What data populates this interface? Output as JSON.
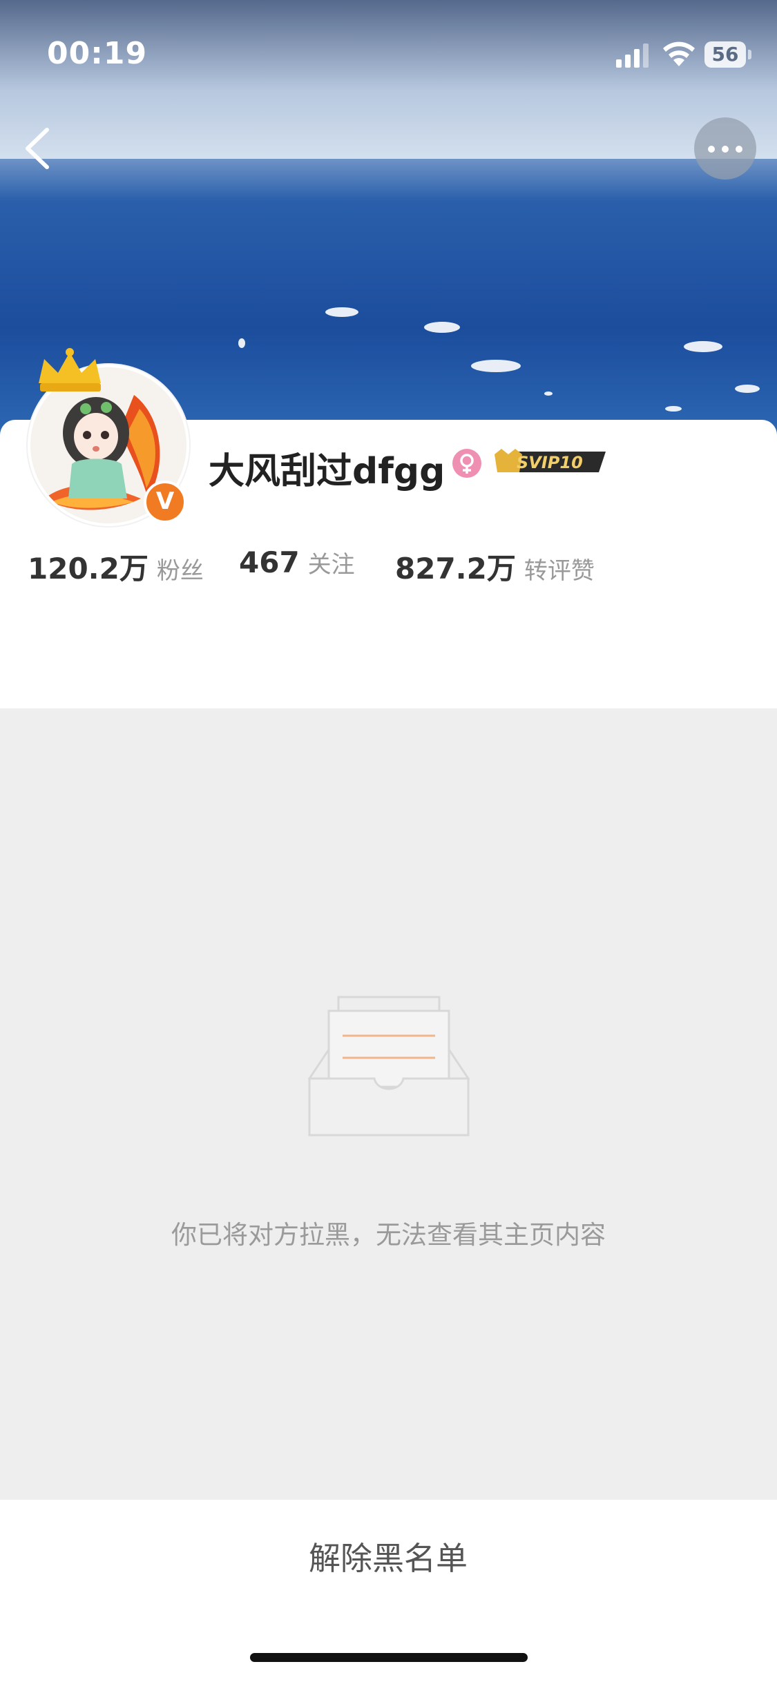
{
  "status_bar": {
    "time": "00:19",
    "battery": "56"
  },
  "profile": {
    "name": "大风刮过dfgg",
    "vip_badge": "SVIP10",
    "verified_badge": "V",
    "stats": [
      {
        "value": "120.2万",
        "label": "粉丝"
      },
      {
        "value": "467",
        "label": "关注"
      },
      {
        "value": "827.2万",
        "label": "转评赞"
      }
    ]
  },
  "blocked": {
    "message": "你已将对方拉黑，无法查看其主页内容"
  },
  "footer": {
    "unblock_label": "解除黑名单"
  },
  "colors": {
    "accent_orange": "#f07b22",
    "gender_pink": "#ef8fb2",
    "blocked_bg": "#eeeeee"
  }
}
